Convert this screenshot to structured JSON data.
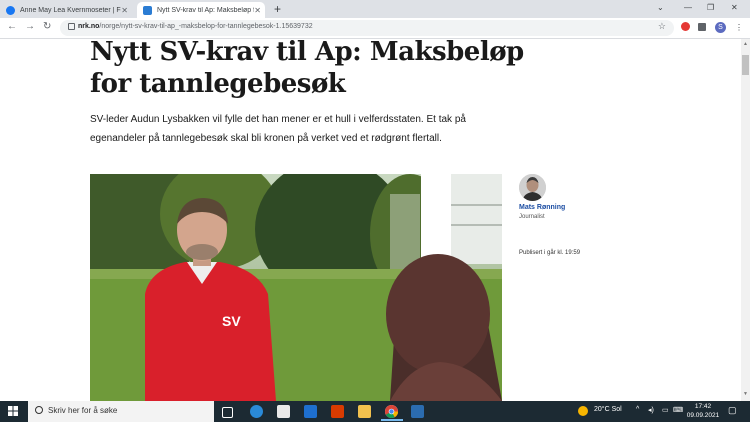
{
  "browser": {
    "tabs": [
      {
        "title": "Anne May Lea Kvernmoseter | Fa",
        "active": false
      },
      {
        "title": "Nytt SV-krav til Ap: Maksbeløp f",
        "active": true
      }
    ],
    "url_domain": "nrk.no",
    "url_path": "/norge/nytt-sv-krav-til-ap_-maksbelop-for-tannlegebesok-1.15639732",
    "profile_initial": "S"
  },
  "article": {
    "headline": "Nytt SV-krav til Ap: Maksbeløp for tannlegebesøk",
    "lead": "SV-leder Audun Lysbakken vil fylle det han mener er et hull i velferdsstaten. Et tak på egenandeler på tannlegebesøk skal bli kronen på verket ved et rødgrønt flertall.",
    "jacket_logo": "SV",
    "author": {
      "name": "Mats Rønning",
      "role": "Journalist"
    },
    "published": "Publisert i går kl. 19:59"
  },
  "taskbar": {
    "search_placeholder": "Skriv her for å søke",
    "weather": "20°C  Sol",
    "time": "17:42",
    "date": "09.09.2021"
  },
  "colors": {
    "headline": "#1a1a1a",
    "author_link": "#1d4ea3",
    "taskbar": "#1c2a33",
    "jacket": "#d9202b"
  }
}
